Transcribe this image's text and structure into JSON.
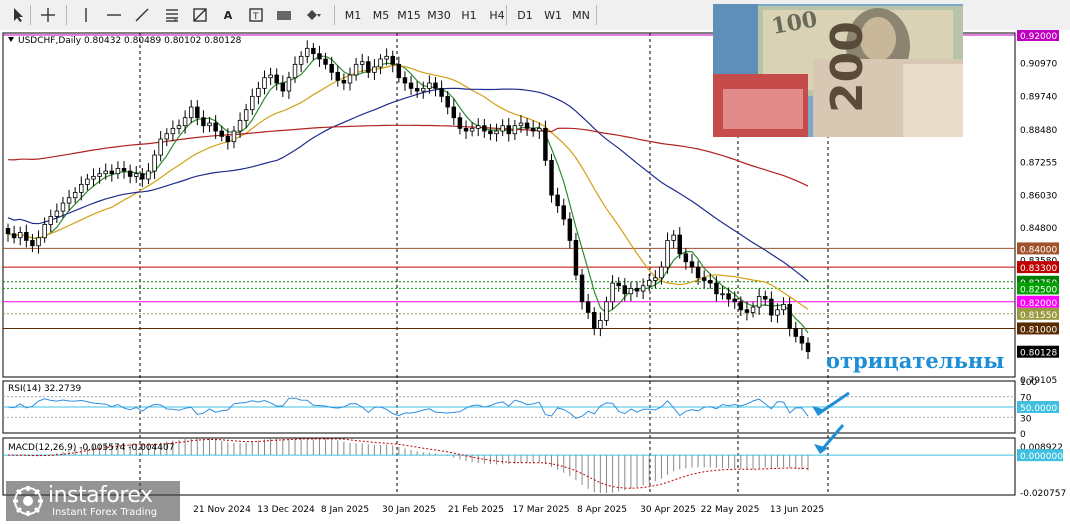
{
  "toolbar": {
    "draw_tools": [
      {
        "name": "cursor-tool",
        "icon": "cursor-icon"
      },
      {
        "name": "crosshair-tool",
        "icon": "crosshair-icon"
      },
      {
        "name": "vertical-line-tool",
        "icon": "vertical-line-icon"
      },
      {
        "name": "horizontal-line-tool",
        "icon": "horizontal-line-icon"
      },
      {
        "name": "trend-line-tool",
        "icon": "trend-line-icon"
      },
      {
        "name": "fibonacci-tool",
        "icon": "fibonacci-icon"
      },
      {
        "name": "fibonacci-fan-tool",
        "icon": "fibonacci-fan-icon"
      },
      {
        "name": "text-tool",
        "icon": "text-icon",
        "label": "A"
      },
      {
        "name": "text-label-tool",
        "icon": "text-label-icon"
      },
      {
        "name": "rectangle-tool",
        "icon": "rectangle-icon"
      },
      {
        "name": "shapes-tool",
        "icon": "shapes-dropdown-icon"
      }
    ],
    "timeframes": [
      "M1",
      "M5",
      "M15",
      "M30",
      "H1",
      "H4",
      "D1",
      "W1",
      "MN"
    ]
  },
  "chart": {
    "symbol_info": "USDCHF,Daily  0.80432 0.80489 0.80102 0.80128",
    "price_labels": [
      "0.92000",
      "0.90970",
      "0.89740",
      "0.88480",
      "0.87255",
      "0.86030",
      "0.84800",
      "0.84000",
      "0.83580",
      "0.83300",
      "0.82750",
      "0.82500",
      "0.82000",
      "0.81550",
      "0.81000",
      "0.80128",
      "0.79105"
    ],
    "date_labels": [
      "21 Nov 2024",
      "13 Dec 2024",
      "8 Jan 2025",
      "30 Jan 2025",
      "21 Feb 2025",
      "17 Mar 2025",
      "8 Apr 2025",
      "30 Apr 2025",
      "22 May 2025",
      "13 Jun 2025"
    ],
    "rsi_title": "RSI(14) 32.2739",
    "rsi_levels": [
      "100",
      "70",
      "50.0000",
      "30",
      "0"
    ],
    "macd_title": "MACD(12,26,9) -0.005574 -0.004407",
    "macd_levels": [
      "0.008922",
      "0.000000",
      "-0.020757"
    ],
    "annotation": "отрицательны",
    "watermark_brand": "instaforex",
    "watermark_tagline": "Instant Forex Trading"
  },
  "chart_data": {
    "type": "candlestick",
    "symbol": "USDCHF",
    "timeframe": "Daily",
    "last_bar": {
      "open": 0.80432,
      "high": 0.80489,
      "low": 0.80102,
      "close": 0.80128
    },
    "price_axis": {
      "min": 0.79105,
      "max": 0.92,
      "ticks": [
        0.92,
        0.9097,
        0.8974,
        0.8848,
        0.87255,
        0.8603,
        0.848,
        0.8358,
        0.8232,
        0.811,
        0.79105
      ]
    },
    "closes": [
      0.8455,
      0.844,
      0.846,
      0.843,
      0.841,
      0.844,
      0.849,
      0.852,
      0.854,
      0.857,
      0.859,
      0.861,
      0.864,
      0.866,
      0.867,
      0.868,
      0.869,
      0.868,
      0.87,
      0.869,
      0.867,
      0.868,
      0.866,
      0.869,
      0.875,
      0.881,
      0.883,
      0.885,
      0.886,
      0.889,
      0.893,
      0.889,
      0.886,
      0.887,
      0.884,
      0.882,
      0.88,
      0.884,
      0.888,
      0.892,
      0.897,
      0.9,
      0.904,
      0.905,
      0.902,
      0.899,
      0.904,
      0.909,
      0.912,
      0.915,
      0.913,
      0.911,
      0.909,
      0.906,
      0.903,
      0.902,
      0.905,
      0.909,
      0.91,
      0.906,
      0.908,
      0.911,
      0.912,
      0.909,
      0.904,
      0.902,
      0.9,
      0.899,
      0.9,
      0.902,
      0.9,
      0.897,
      0.893,
      0.889,
      0.885,
      0.884,
      0.885,
      0.886,
      0.884,
      0.883,
      0.884,
      0.886,
      0.883,
      0.886,
      0.887,
      0.885,
      0.884,
      0.885,
      0.873,
      0.86,
      0.856,
      0.851,
      0.843,
      0.83,
      0.82,
      0.816,
      0.81,
      0.813,
      0.82,
      0.827,
      0.826,
      0.823,
      0.825,
      0.824,
      0.826,
      0.828,
      0.829,
      0.833,
      0.843,
      0.845,
      0.838,
      0.835,
      0.833,
      0.829,
      0.828,
      0.827,
      0.823,
      0.823,
      0.821,
      0.82,
      0.817,
      0.816,
      0.818,
      0.822,
      0.821,
      0.815,
      0.817,
      0.819,
      0.81,
      0.807,
      0.8045,
      0.8013
    ],
    "moving_averages": [
      {
        "color": "#2e8b2e",
        "period": "fast"
      },
      {
        "color": "#d4a017",
        "period": "medium"
      },
      {
        "color": "#1f2d8c",
        "period": "slow"
      },
      {
        "color": "#b22222",
        "period": "long"
      }
    ],
    "horizontal_levels": [
      {
        "price": 0.92,
        "color": "#c000c0",
        "style": "solid"
      },
      {
        "price": 0.84,
        "color": "#a0522d",
        "style": "solid"
      },
      {
        "price": 0.833,
        "color": "#c00000",
        "style": "solid"
      },
      {
        "price": 0.8275,
        "color": "#008000",
        "style": "dotted"
      },
      {
        "price": 0.825,
        "color": "#00a000",
        "style": "dotted"
      },
      {
        "price": 0.82,
        "color": "#ff00ff",
        "style": "solid"
      },
      {
        "price": 0.8155,
        "color": "#9a9a40",
        "style": "dotted"
      },
      {
        "price": 0.81,
        "color": "#5a2a00",
        "style": "solid"
      }
    ],
    "rsi": {
      "period": 14,
      "value": 32.2739,
      "levels": [
        70,
        50,
        30
      ],
      "ylim": [
        0,
        100
      ]
    },
    "macd": {
      "params": "12,26,9",
      "main": -0.005574,
      "signal": -0.004407,
      "ylim": [
        -0.020757,
        0.008922
      ]
    }
  }
}
